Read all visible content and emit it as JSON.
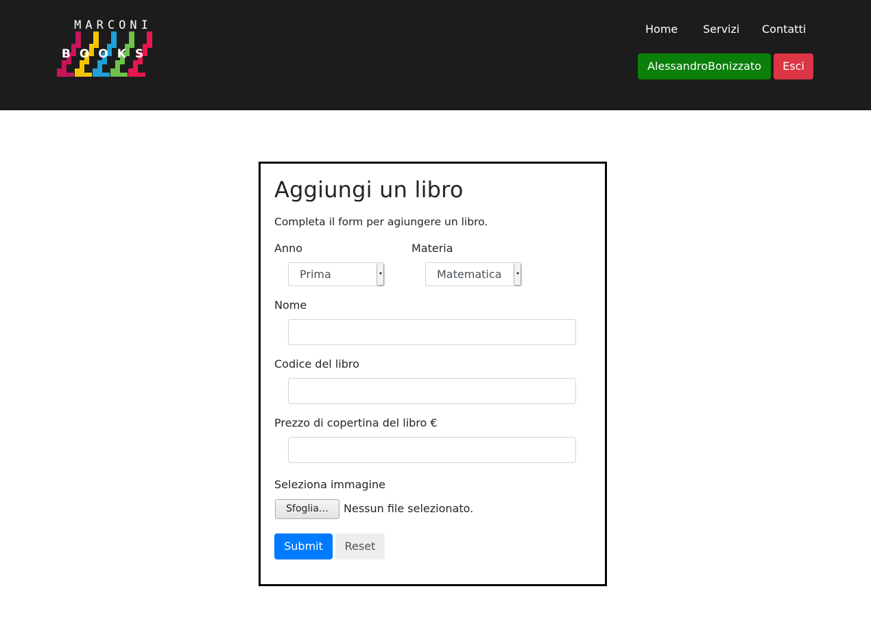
{
  "header": {
    "logo": {
      "line1": "MARCONI",
      "line2": "BOOKS",
      "colors": [
        "#c8145a",
        "#f5c400",
        "#1fa0d8",
        "#6cc24a",
        "#e8164e"
      ]
    },
    "nav": [
      "Home",
      "Servizi",
      "Contatti"
    ],
    "user_button": "AlessandroBonizzato",
    "logout_button": "Esci"
  },
  "form": {
    "title": "Aggiungi un libro",
    "subtitle": "Completa il form per agiungere un libro.",
    "anno": {
      "label": "Anno",
      "selected": "Prima"
    },
    "materia": {
      "label": "Materia",
      "selected": "Matematica"
    },
    "nome": {
      "label": "Nome",
      "value": ""
    },
    "codice": {
      "label": "Codice del libro",
      "value": ""
    },
    "prezzo": {
      "label": "Prezzo di copertina del libro €",
      "value": ""
    },
    "immagine": {
      "label": "Seleziona immagine",
      "browse_button": "Sfoglia…",
      "status": "Nessun file selezionato."
    },
    "submit_label": "Submit",
    "reset_label": "Reset"
  },
  "colors": {
    "header_bg": "#1c1c1c",
    "user_button": "#0a7f0a",
    "logout_button": "#dc3545",
    "submit_button": "#007bff",
    "reset_button": "#eeeeee"
  }
}
